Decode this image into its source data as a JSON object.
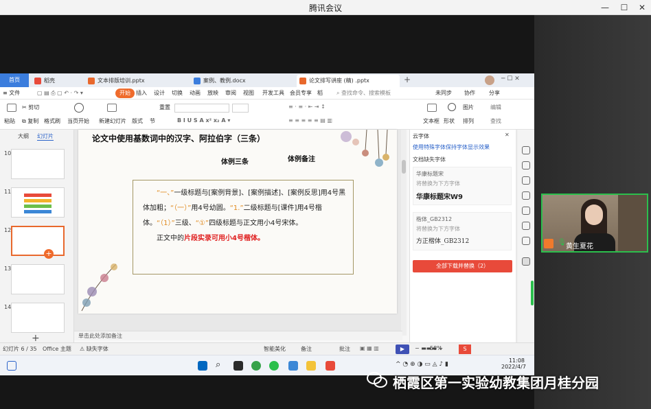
{
  "meeting": {
    "title": "腾讯会议",
    "participant_name": "黄生夏花"
  },
  "wps": {
    "home_tab": "首页",
    "tabs": [
      {
        "label": "稻壳",
        "color": "#e84a3a"
      },
      {
        "label": "文本排版培训.pptx",
        "color": "#e8682c"
      },
      {
        "label": "案例、教例.docx",
        "color": "#3b7ddd"
      },
      {
        "label": "论文排写讲座 (精) .pptx",
        "color": "#e8682c"
      }
    ],
    "menu": [
      "≡ 文件",
      "开始",
      "插入",
      "设计",
      "切换",
      "动画",
      "放映",
      "审阅",
      "视图",
      "开发工具",
      "会员专享",
      "稻"
    ],
    "menu_active": "开始",
    "search_placeholder": "查找命令、搜索模板",
    "menu_right": [
      "未同步",
      "协作",
      "分享"
    ],
    "ribbon": {
      "paste": "粘贴",
      "cut": "剪切",
      "copy": "复制",
      "format_painter": "格式刷",
      "play": "当页开始",
      "new_slide": "新建幻灯片",
      "layout": "版式",
      "section": "节",
      "reset": "重置",
      "textbox": "文本框",
      "shape": "形状",
      "image": "图片",
      "arrange": "排列",
      "format": "编辑",
      "find": "查找"
    },
    "left_panel": {
      "tab_outline": "大纲",
      "tab_slides": "幻灯片",
      "slide_numbers": [
        "10",
        "11",
        "12",
        "13",
        "14"
      ],
      "add": "+"
    },
    "slide": {
      "title": "论文中使用基数词中的汉字、阿拉伯字（三条）",
      "label_left": "体例三条",
      "label_right": "体例备注",
      "para1_parts": [
        {
          "t": "“一、”",
          "c": "orange"
        },
        {
          "t": "一级标题与[案例背景]、[案例描述]、[案例反思]用4号黑体加粗；",
          "c": ""
        },
        {
          "t": "“（一）”",
          "c": "orange"
        },
        {
          "t": "用4号幼圆。",
          "c": ""
        },
        {
          "t": "“1.”",
          "c": "orange"
        },
        {
          "t": "二级标题与[课件]用4号楷体。",
          "c": ""
        },
        {
          "t": "“（1）”",
          "c": "orange"
        },
        {
          "t": "三级、",
          "c": ""
        },
        {
          "t": "“①”",
          "c": "orange"
        },
        {
          "t": "四级标题与正文用小4号宋体。",
          "c": ""
        }
      ],
      "para2_prefix": "正文中的",
      "para2_red": "片段实录可用小4号楷体。"
    },
    "notes_placeholder": "单击此处添加备注",
    "status": {
      "slide_count": "幻灯片 6 / 35",
      "theme": "Office 主题",
      "font_missing": "缺失字体",
      "beautify": "智能美化",
      "notes": "备注",
      "comments": "批注",
      "zoom": "58%"
    },
    "font_pane": {
      "title": "云字体",
      "link": "使用特殊字体保持字体显示效果",
      "section": "文档缺失字体",
      "fonts": [
        {
          "name": "华康标题宋W9",
          "hint": "华康标题宋",
          "sub": "将替换为下方字体"
        },
        {
          "name": "方正楷体_GB2312",
          "hint": "楷体_GB2312",
          "sub": "将替换为下方字体"
        }
      ],
      "download_all": "全部下载并替换（2）"
    }
  },
  "taskbar": {
    "time": "11:08",
    "date": "2022/4/7"
  },
  "watermark": {
    "text": "栖霞区第一实验幼教集团月桂分园"
  }
}
